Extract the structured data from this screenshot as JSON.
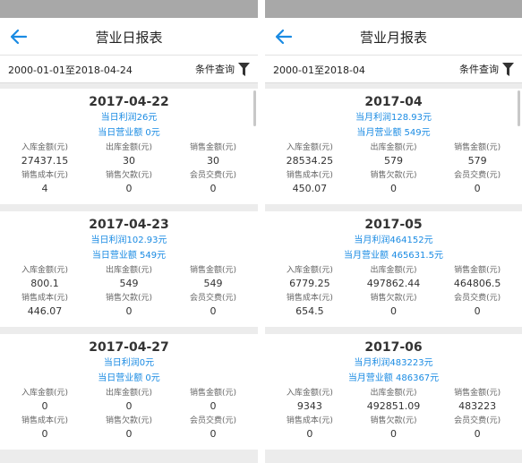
{
  "stat_labels": [
    "入库金额(元)",
    "出库金额(元)",
    "销售金额(元)",
    "销售成本(元)",
    "销售欠款(元)",
    "会员交费(元)"
  ],
  "daily": {
    "title": "营业日报表",
    "range": "2000-01-01至2018-04-24",
    "query_label": "条件查询",
    "cards": [
      {
        "date": "2017-04-22",
        "profit": "当日利润26元",
        "turnover": "当日营业额 0元",
        "values": [
          "27437.15",
          "30",
          "30",
          "4",
          "0",
          "0"
        ]
      },
      {
        "date": "2017-04-23",
        "profit": "当日利润102.93元",
        "turnover": "当日营业额 549元",
        "values": [
          "800.1",
          "549",
          "549",
          "446.07",
          "0",
          "0"
        ]
      },
      {
        "date": "2017-04-27",
        "profit": "当日利润0元",
        "turnover": "当日营业额 0元",
        "values": [
          "0",
          "0",
          "0",
          "0",
          "0",
          "0"
        ]
      }
    ]
  },
  "monthly": {
    "title": "营业月报表",
    "range": "2000-01至2018-04",
    "query_label": "条件查询",
    "cards": [
      {
        "date": "2017-04",
        "profit": "当月利润128.93元",
        "turnover": "当月营业额 549元",
        "values": [
          "28534.25",
          "579",
          "579",
          "450.07",
          "0",
          "0"
        ]
      },
      {
        "date": "2017-05",
        "profit": "当月利润464152元",
        "turnover": "当月营业额 465631.5元",
        "values": [
          "6779.25",
          "497862.44",
          "464806.5",
          "654.5",
          "0",
          "0"
        ]
      },
      {
        "date": "2017-06",
        "profit": "当月利润483223元",
        "turnover": "当月营业额 486367元",
        "values": [
          "9343",
          "492851.09",
          "483223",
          "0",
          "0",
          "0"
        ]
      }
    ]
  },
  "colors": {
    "accent": "#1a8be3",
    "status_bar": "#a8a8a8",
    "background": "#ececec"
  },
  "icons": {
    "back": "arrow-left-icon",
    "filter": "funnel-icon"
  }
}
